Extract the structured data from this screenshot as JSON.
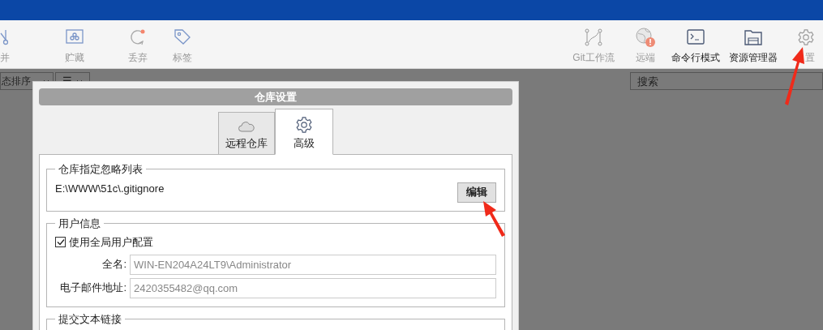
{
  "toolbar_left": [
    {
      "kind": "merge",
      "label": "并",
      "disabled": true
    },
    {
      "kind": "stash",
      "label": "贮藏",
      "disabled": true
    },
    {
      "kind": "discard",
      "label": "丢弃",
      "disabled": true
    },
    {
      "kind": "tag",
      "label": "标签",
      "disabled": true
    }
  ],
  "toolbar_right": [
    {
      "kind": "flow",
      "label": "Git工作流",
      "disabled": true
    },
    {
      "kind": "remote",
      "label": "远端",
      "disabled": true
    },
    {
      "kind": "terminal",
      "label": "命令行模式",
      "disabled": false
    },
    {
      "kind": "explorer",
      "label": "资源管理器",
      "disabled": false
    },
    {
      "kind": "settings",
      "label": "置",
      "disabled": true
    }
  ],
  "filter_bar": {
    "sort": "态排序",
    "view": "☰",
    "search": {
      "placeholder": "搜索"
    }
  },
  "dialog": {
    "title": "仓库设置",
    "tabs": [
      {
        "kind": "cloud",
        "label": "远程仓库",
        "selected": false
      },
      {
        "kind": "gear",
        "label": "高级",
        "selected": true
      }
    ],
    "ignore_group": {
      "legend": "仓库指定忽略列表",
      "path": "E:\\WWW\\51c\\.gitignore",
      "button": "编辑"
    },
    "user_group": {
      "legend": "用户信息",
      "use_global": {
        "label": "使用全局用户配置",
        "checked": true
      },
      "fields": [
        {
          "label": "全名:",
          "value": "WIN-EN204A24LT9\\Administrator",
          "disabled": true
        },
        {
          "label": "电子邮件地址:",
          "value": "2420355482@qq.com",
          "disabled": true
        }
      ]
    },
    "hooks_group": {
      "legend": "提交文本链接"
    }
  }
}
